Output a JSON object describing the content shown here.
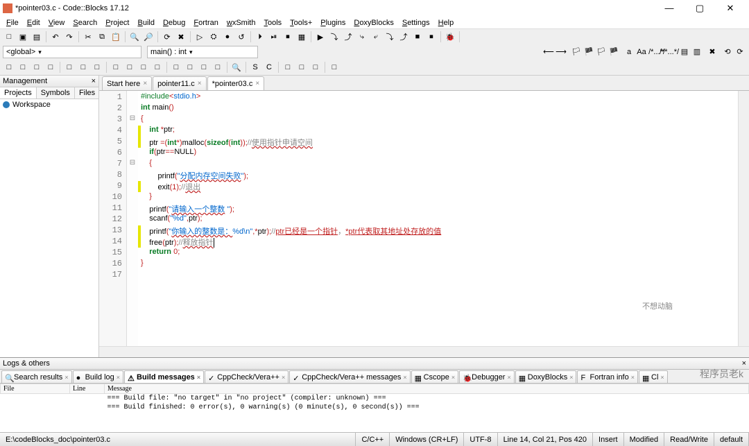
{
  "window": {
    "title": "*pointer03.c - Code::Blocks 17.12",
    "min": "—",
    "max": "▢",
    "close": "✕"
  },
  "menus": [
    "File",
    "Edit",
    "View",
    "Search",
    "Project",
    "Build",
    "Debug",
    "Fortran",
    "wxSmith",
    "Tools",
    "Tools+",
    "Plugins",
    "DoxyBlocks",
    "Settings",
    "Help"
  ],
  "toolbar_row1": {
    "icons": [
      "□",
      "▣",
      "▤",
      "|",
      "↶",
      "↷",
      "|",
      "✂",
      "⧉",
      "📋",
      "|",
      "🔍",
      "🔎",
      "|",
      "⟳",
      "✖",
      "|",
      "▷",
      "⛭",
      "●",
      "↺",
      "|",
      "⏵",
      "⏯",
      "⏹"
    ],
    "icons2": [
      "▦",
      "|",
      "▶",
      "⤵",
      "⤴",
      "⤷",
      "⤶",
      "⤵",
      "⤴",
      "■",
      "⏹",
      "|",
      "🐞",
      "|"
    ]
  },
  "toolbar_row2_left": {
    "scope": "<global>",
    "func": "main() : int"
  },
  "toolbar_row2_right_icons": [
    "⟵",
    "⟶",
    "|",
    "🏳",
    "🏴",
    "🏳",
    "🏴",
    "|",
    "a",
    "Aa",
    "|",
    "/*...*/",
    "/**...*/",
    "|",
    "▤",
    "▥",
    "|",
    "✖",
    "|",
    "⟲",
    "⟳"
  ],
  "toolbar_row3_icons": [
    "□",
    "□",
    "□",
    "□",
    "|",
    "□",
    "□",
    "□",
    "|",
    "□",
    "□",
    "□",
    "□",
    "|",
    "□",
    "□",
    "□",
    "□",
    "|",
    "🔍",
    "|",
    "S",
    "C",
    "|",
    "□",
    "□",
    "□",
    "|",
    "□"
  ],
  "management": {
    "title": "Management",
    "tabs": [
      "Projects",
      "Symbols",
      "Files"
    ],
    "workspace": "Workspace"
  },
  "editor_tabs": [
    {
      "label": "Start here",
      "active": false
    },
    {
      "label": "pointer11.c",
      "active": false
    },
    {
      "label": "*pointer03.c",
      "active": true
    }
  ],
  "code_lines": [
    {
      "n": 1,
      "ch": "",
      "fold": "",
      "html": "<span class='pp'>#include</span><span class='op'>&lt;</span><span class='str'>stdio.h</span><span class='op'>&gt;</span>"
    },
    {
      "n": 2,
      "ch": "",
      "fold": "",
      "html": "<span class='kw'>int</span> main<span class='op'>()</span>"
    },
    {
      "n": 3,
      "ch": "",
      "fold": "⊟",
      "html": "<span class='op'>{</span>"
    },
    {
      "n": 4,
      "ch": "m",
      "fold": "",
      "html": "    <span class='kw'>int</span> <span class='op'>*</span>ptr<span class='op'>;</span>"
    },
    {
      "n": 5,
      "ch": "m",
      "fold": "",
      "html": "    ptr <span class='op'>=(</span><span class='kw'>int</span><span class='op'>*)</span>malloc<span class='op'>(</span><span class='kw'>sizeof</span><span class='op'>(</span><span class='kw'>int</span><span class='op'>));</span><span class='cmt'>//<span class='undc'>使用指针申请空间</span></span>"
    },
    {
      "n": 6,
      "ch": "",
      "fold": "",
      "html": "    <span class='kw'>if</span><span class='op'>(</span>ptr<span class='op'>==</span>NULL<span class='op'>)</span>"
    },
    {
      "n": 7,
      "ch": "",
      "fold": "⊟",
      "html": "    <span class='op'>{</span>"
    },
    {
      "n": 8,
      "ch": "",
      "fold": "",
      "html": "        printf<span class='op'>(</span><span class='str'>\"<span class='undc'>分配内存空间失败</span>\"</span><span class='op'>);</span>"
    },
    {
      "n": 9,
      "ch": "m",
      "fold": "",
      "html": "        exit<span class='op'>(</span><span class='num'>1</span><span class='op'>);</span><span class='cmt'>//<span class='undc'>退出</span></span>"
    },
    {
      "n": 10,
      "ch": "",
      "fold": "",
      "html": "    <span class='op'>}</span>"
    },
    {
      "n": 11,
      "ch": "",
      "fold": "",
      "html": "    printf<span class='op'>(</span><span class='str'>\"<span class='undc'>请输入一个整数</span> \"</span><span class='op'>);</span>"
    },
    {
      "n": 12,
      "ch": "",
      "fold": "",
      "html": "    scanf<span class='op'>(</span><span class='str'>\"%d\"</span><span class='op'>,</span>ptr<span class='op'>);</span>"
    },
    {
      "n": 13,
      "ch": "m",
      "fold": "",
      "html": "    printf<span class='op'>(</span><span class='str'>\"<span class='undc'>你输入的整数是：</span>%d\\n\"</span><span class='op'>,*</span>ptr<span class='op'>);</span><span class='cmt'>//<span class='und'>ptr已经是一个指针</span>，<span class='und'>*ptr代表取其地址处存放的值</span></span>"
    },
    {
      "n": 14,
      "ch": "m",
      "fold": "",
      "html": "    free<span class='op'>(</span>ptr<span class='op'>);</span><span class='cmt'>//<span class='undc'>释放指针</span></span><span class='caret'></span>"
    },
    {
      "n": 15,
      "ch": "",
      "fold": "",
      "html": "    <span class='kw'>return</span> <span class='num'>0</span><span class='op'>;</span>"
    },
    {
      "n": 16,
      "ch": "",
      "fold": "",
      "html": "<span class='op'>}</span>"
    },
    {
      "n": 17,
      "ch": "",
      "fold": "",
      "html": ""
    }
  ],
  "logs": {
    "title": "Logs & others",
    "tabs": [
      {
        "label": "Search results",
        "icon": "🔍"
      },
      {
        "label": "Build log",
        "icon": "●"
      },
      {
        "label": "Build messages",
        "icon": "⚠",
        "active": true
      },
      {
        "label": "CppCheck/Vera++",
        "icon": "✓"
      },
      {
        "label": "CppCheck/Vera++ messages",
        "icon": "✓"
      },
      {
        "label": "Cscope",
        "icon": "▦"
      },
      {
        "label": "Debugger",
        "icon": "🐞"
      },
      {
        "label": "DoxyBlocks",
        "icon": "▦"
      },
      {
        "label": "Fortran info",
        "icon": "F"
      },
      {
        "label": "Cl",
        "icon": "▦"
      }
    ],
    "cols": [
      "File",
      "Line",
      "Message"
    ],
    "rows": [
      {
        "file": "",
        "line": "",
        "msg": "=== Build file: \"no target\" in \"no project\" (compiler: unknown) ==="
      },
      {
        "file": "",
        "line": "",
        "msg": "=== Build finished: 0 error(s), 0 warning(s) (0 minute(s), 0 second(s)) ==="
      }
    ]
  },
  "status": {
    "path": "E:\\codeBlocks_doc\\pointer03.c",
    "lang": "C/C++",
    "eol": "Windows (CR+LF)",
    "enc": "UTF-8",
    "pos": "Line 14, Col 21, Pos 420",
    "ins": "Insert",
    "mod": "Modified",
    "rw": "Read/Write",
    "prof": "default"
  },
  "watermark": "程序员老k",
  "mascot": "不想动脑"
}
